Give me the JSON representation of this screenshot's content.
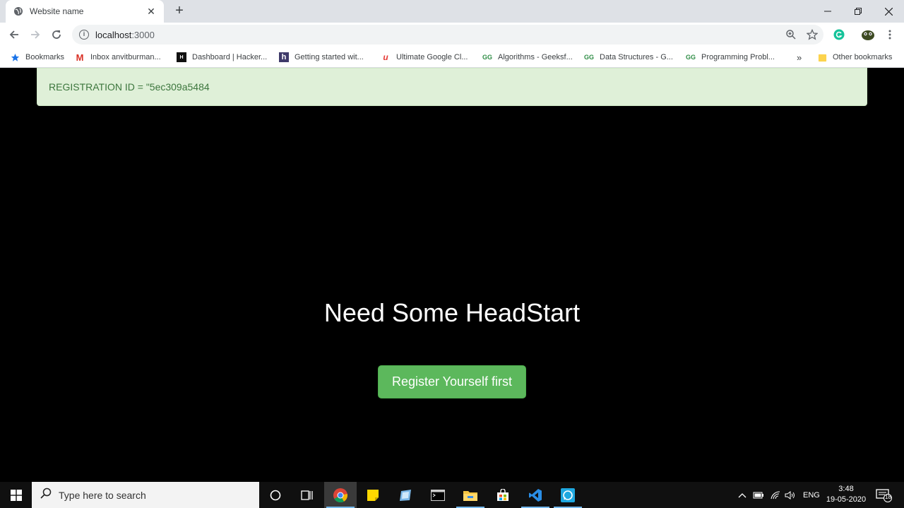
{
  "browser": {
    "tab_title": "Website name",
    "new_tab": "+",
    "url_host": "localhost",
    "url_port": ":3000",
    "bookmarks": [
      {
        "label": "Bookmarks",
        "icon": "star-icon"
      },
      {
        "label": "Inbox anvitburman...",
        "icon": "gmail-icon"
      },
      {
        "label": "Dashboard | Hacker...",
        "icon": "hackerrank-icon"
      },
      {
        "label": "Getting started wit...",
        "icon": "heroku-icon"
      },
      {
        "label": "Ultimate Google Cl...",
        "icon": "udemy-icon"
      },
      {
        "label": "Algorithms - Geeksf...",
        "icon": "geeksforgeeks-icon"
      },
      {
        "label": "Data Structures - G...",
        "icon": "geeksforgeeks-icon"
      },
      {
        "label": "Programming Probl...",
        "icon": "geeksforgeeks-icon"
      }
    ],
    "overflow": "»",
    "other_bookmarks": "Other bookmarks"
  },
  "page": {
    "alert_text": "REGISTRATION ID = \"5ec309a5484",
    "headline": "Need Some HeadStart",
    "cta_label": "Register Yourself first"
  },
  "taskbar": {
    "search_placeholder": "Type here to search",
    "language": "ENG",
    "time": "3:48",
    "date": "19-05-2020",
    "notification_count": "18"
  },
  "colors": {
    "alert_bg": "#dff0d8",
    "alert_text": "#3c763d",
    "cta_bg": "#5cb85c",
    "page_bg": "#000000"
  }
}
